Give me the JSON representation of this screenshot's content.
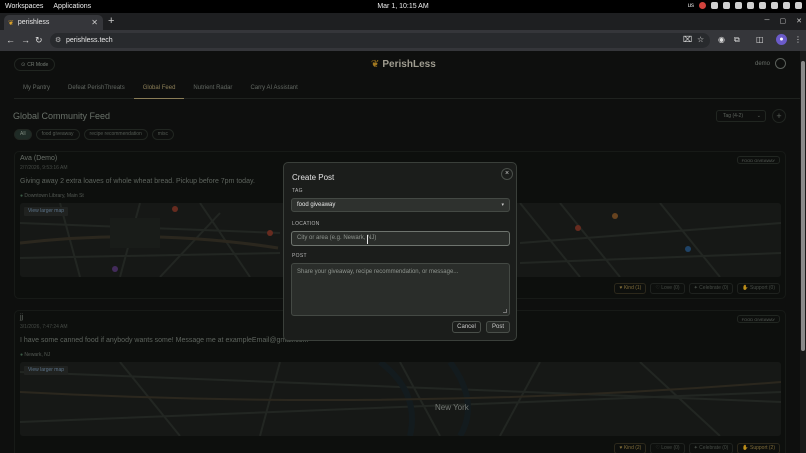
{
  "os": {
    "menu": [
      "Workspaces",
      "Applications"
    ],
    "clock": "Mar 1, 10:15 AM",
    "keyboard": "us"
  },
  "browser": {
    "tab_title": "perishless",
    "new_tab": "+",
    "url": "perishless.tech"
  },
  "app": {
    "cr_label": "CR Mode",
    "logo": "PerishLess",
    "user": "demo",
    "nav_tabs": [
      "My Pantry",
      "Defeat PerishThreats",
      "Global Feed",
      "Nutrient Radar",
      "Carry AI Assistant"
    ],
    "feed_title": "Global Community Feed",
    "tag_select": "Tag (4-2)",
    "add": "+",
    "chips": [
      "All",
      "food giveaway",
      "recipe recommendation",
      "misc"
    ]
  },
  "posts": [
    {
      "author": "Ava (Demo)",
      "date": "2/7/2026, 9:53:16 AM",
      "tag": "FOOD GIVEAWAY",
      "text": "Giving away 2 extra loaves of whole wheat bread. Pickup before 7pm today.",
      "location": "Downtown Library, Main St",
      "map_link": "View larger map",
      "reactions": [
        "Kind (1)",
        "Love (0)",
        "Celebrate (0)",
        "Support (0)"
      ]
    },
    {
      "author": "jj",
      "date": "3/1/2026, 7:47:24 AM",
      "tag": "FOOD GIVEAWAY",
      "text": "I have some canned food if anybody wants some! Message me at exampleEmail@gmail.com",
      "location": "Newark, NJ",
      "map_link": "View larger map",
      "map_label": "New York",
      "reactions": [
        "Kind (2)",
        "Love (0)",
        "Celebrate (0)",
        "Support (2)"
      ]
    }
  ],
  "modal": {
    "title": "Create Post",
    "close": "×",
    "tag_label": "TAG",
    "tag_value": "food giveaway",
    "location_label": "LOCATION",
    "location_placeholder": "City or area (e.g. Newark, NJ)",
    "post_label": "POST",
    "post_placeholder": "Share your giveaway, recipe recommendation, or message...",
    "cancel": "Cancel",
    "submit": "Post"
  }
}
